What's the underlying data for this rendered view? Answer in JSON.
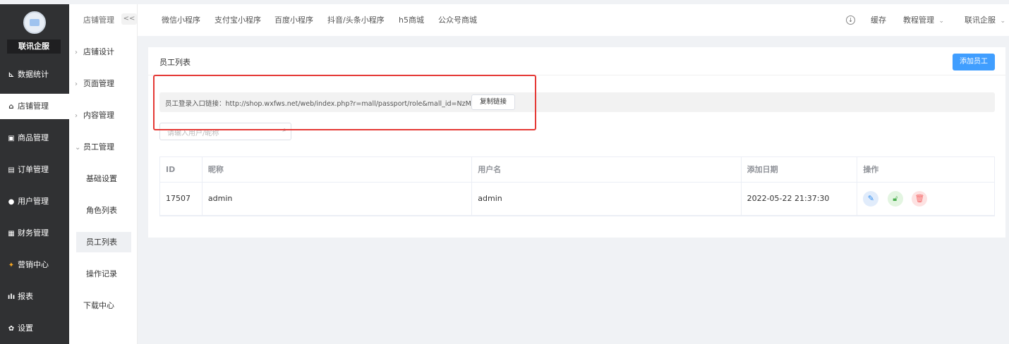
{
  "brand": {
    "name": "联讯企服"
  },
  "sidebar": {
    "items": [
      {
        "label": "数据统计",
        "icon": "chart-icon",
        "glyph": "⊾"
      },
      {
        "label": "店铺管理",
        "icon": "shop-icon",
        "glyph": "⌂",
        "active": true
      },
      {
        "label": "商品管理",
        "icon": "goods-icon",
        "glyph": "▣"
      },
      {
        "label": "订单管理",
        "icon": "order-icon",
        "glyph": "▤"
      },
      {
        "label": "用户管理",
        "icon": "user-icon",
        "glyph": "●"
      },
      {
        "label": "财务管理",
        "icon": "finance-icon",
        "glyph": "▦"
      },
      {
        "label": "营销中心",
        "icon": "marketing-icon",
        "glyph": "✦"
      },
      {
        "label": "报表",
        "icon": "report-icon",
        "glyph": "ılı"
      },
      {
        "label": "设置",
        "icon": "settings-icon",
        "glyph": "✿"
      }
    ]
  },
  "subnav": {
    "title": "店铺管理",
    "collapse": "<<",
    "items": [
      {
        "label": "店铺设计",
        "chevron": "›"
      },
      {
        "label": "页面管理",
        "chevron": "›"
      },
      {
        "label": "内容管理",
        "chevron": "›"
      },
      {
        "label": "员工管理",
        "chevron": "⌄"
      }
    ],
    "subitems": [
      {
        "label": "基础设置"
      },
      {
        "label": "角色列表"
      },
      {
        "label": "员工列表",
        "active": true
      },
      {
        "label": "操作记录"
      }
    ],
    "download": "下载中心"
  },
  "topbar": {
    "tabs": [
      "微信小程序",
      "支付宝小程序",
      "百度小程序",
      "抖音/头条小程序",
      "h5商城",
      "公众号商城"
    ],
    "cache": "缓存",
    "tutorial": "教程管理",
    "account": "联讯企服"
  },
  "panel": {
    "title": "员工列表",
    "add_button": "添加员工",
    "link_text": "员工登录入口链接：http://shop.wxfws.net/web/index.php?r=mall/passport/role&mall_id=NzM=",
    "copy_button": "复制链接",
    "search_placeholder": "请输入用户/昵称"
  },
  "table": {
    "headers": [
      "ID",
      "昵称",
      "用户名",
      "添加日期",
      "操作"
    ],
    "rows": [
      {
        "id": "17507",
        "nickname": "admin",
        "username": "admin",
        "date": "2022-05-22 21:37:30"
      }
    ]
  },
  "colors": {
    "primary": "#409eff",
    "sidebar_bg": "#303133",
    "highlight": "#e53935"
  }
}
